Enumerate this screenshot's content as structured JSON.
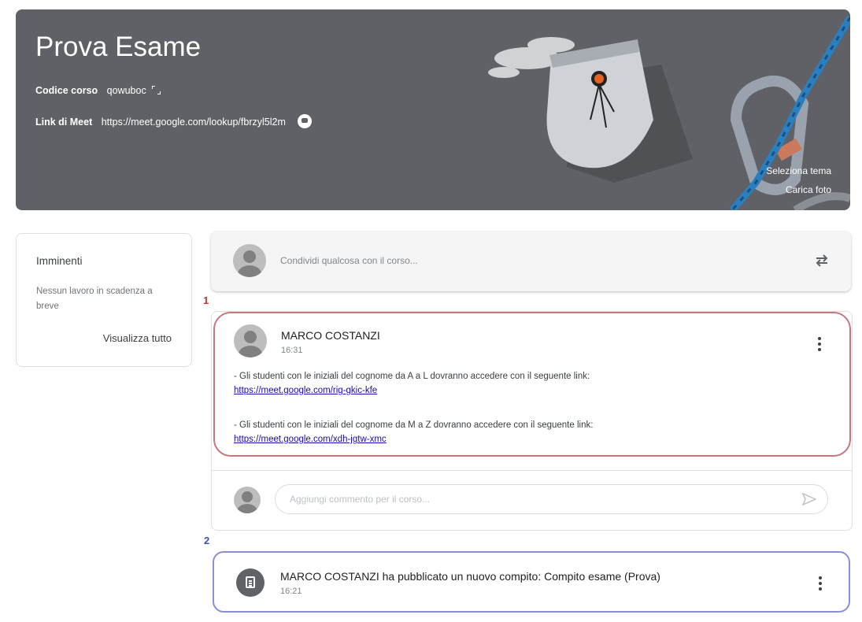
{
  "banner": {
    "title": "Prova Esame",
    "course_code_label": "Codice corso",
    "course_code": "qowuboc",
    "meet_label": "Link di Meet",
    "meet_url": "https://meet.google.com/lookup/fbrzyl5l2m",
    "select_theme": "Seleziona tema",
    "upload_photo": "Carica foto"
  },
  "upcoming": {
    "title": "Imminenti",
    "text": "Nessun lavoro in scadenza a breve",
    "view_all": "Visualizza tutto"
  },
  "share": {
    "placeholder": "Condividi qualcosa con il corso..."
  },
  "markers": {
    "first": "1",
    "second": "2"
  },
  "post": {
    "author": "MARCO COSTANZI",
    "time": "16:31",
    "line1": "- Gli studenti con le iniziali del cognome da A a L dovranno accedere con il seguente link:",
    "link1": "https://meet.google.com/rig-gkic-kfe",
    "line2": "- Gli studenti con le iniziali del cognome da M a Z dovranno accedere con il seguente link:",
    "link2": "https://meet.google.com/xdh-jgtw-xmc",
    "comment_placeholder": "Aggiungi commento per il corso..."
  },
  "assignment": {
    "title": "MARCO COSTANZI ha pubblicato un nuovo compito: Compito esame (Prova)",
    "time": "16:21"
  },
  "colors": {
    "banner_bg": "#5f6166",
    "highlight_red": "#c7787e",
    "highlight_blue": "#8a8fd8"
  }
}
